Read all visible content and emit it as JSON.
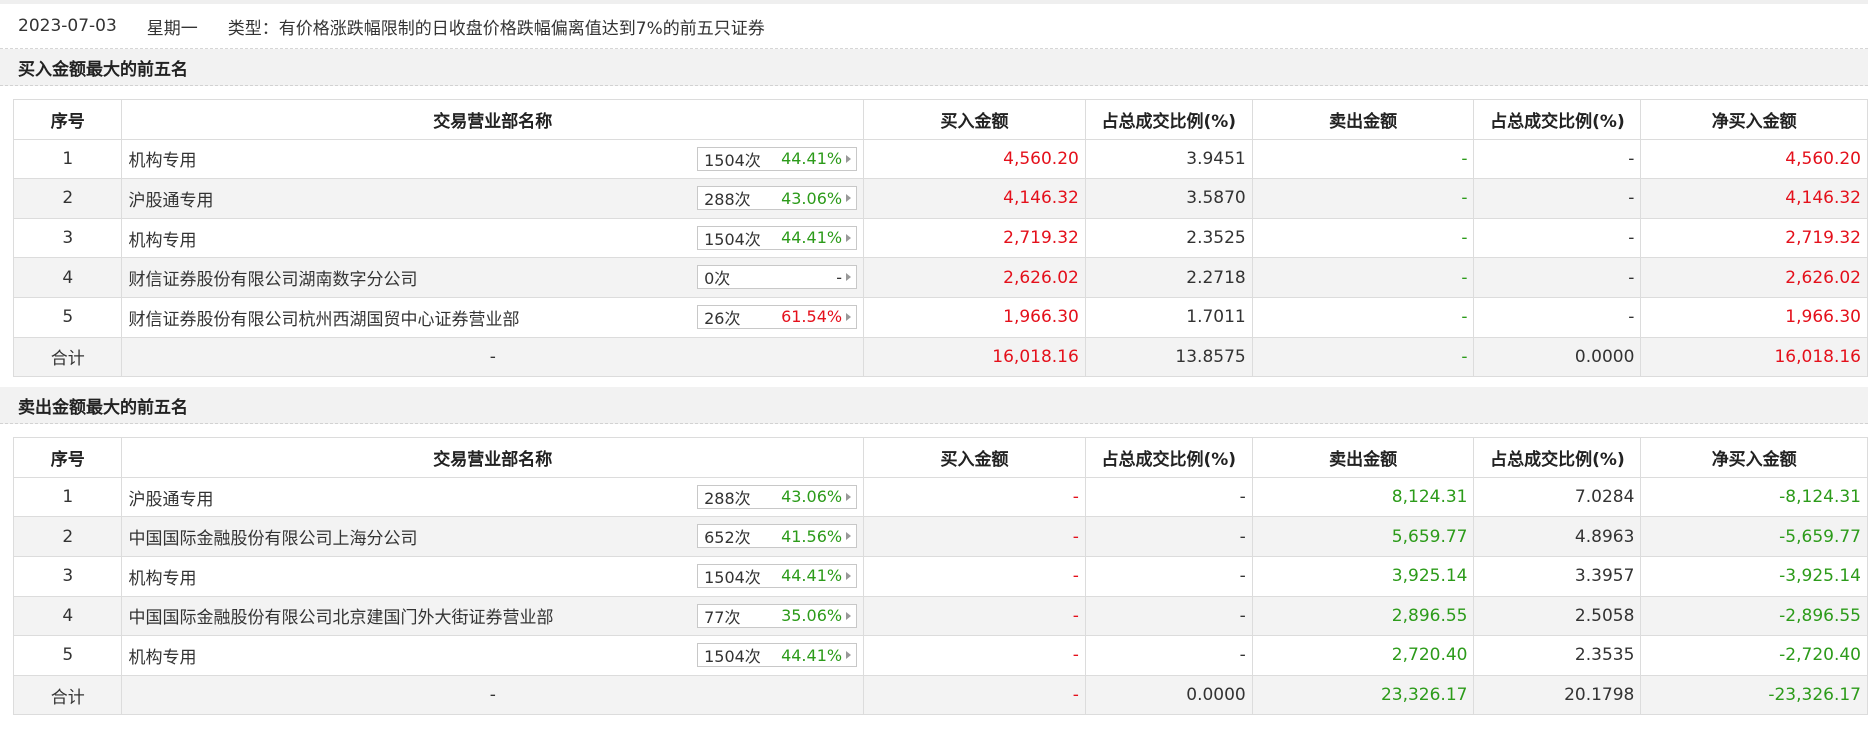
{
  "info": {
    "date": "2023-07-03",
    "weekday": "星期一",
    "type_text": "类型：有价格涨跌幅限制的日收盘价格跌幅偏离值达到7%的前五只证券"
  },
  "columns": [
    "序号",
    "交易营业部名称",
    "买入金额",
    "占总成交比例(%)",
    "卖出金额",
    "占总成交比例(%)",
    "净买入金额"
  ],
  "buy_section": {
    "title": "买入金额最大的前五名",
    "rows": [
      {
        "idx": "1",
        "name": "机构专用",
        "count": "1504次",
        "pct": "44.41%",
        "pct_color": "green",
        "buy": "4,560.20",
        "buy_ratio": "3.9451",
        "sell": "-",
        "sell_ratio": "-",
        "net": "4,560.20"
      },
      {
        "idx": "2",
        "name": "沪股通专用",
        "count": "288次",
        "pct": "43.06%",
        "pct_color": "green",
        "buy": "4,146.32",
        "buy_ratio": "3.5870",
        "sell": "-",
        "sell_ratio": "-",
        "net": "4,146.32"
      },
      {
        "idx": "3",
        "name": "机构专用",
        "count": "1504次",
        "pct": "44.41%",
        "pct_color": "green",
        "buy": "2,719.32",
        "buy_ratio": "2.3525",
        "sell": "-",
        "sell_ratio": "-",
        "net": "2,719.32"
      },
      {
        "idx": "4",
        "name": "财信证券股份有限公司湖南数字分公司",
        "count": "0次",
        "pct": "-",
        "pct_color": "gray",
        "buy": "2,626.02",
        "buy_ratio": "2.2718",
        "sell": "-",
        "sell_ratio": "-",
        "net": "2,626.02"
      },
      {
        "idx": "5",
        "name": "财信证券股份有限公司杭州西湖国贸中心证券营业部",
        "count": "26次",
        "pct": "61.54%",
        "pct_color": "red",
        "buy": "1,966.30",
        "buy_ratio": "1.7011",
        "sell": "-",
        "sell_ratio": "-",
        "net": "1,966.30"
      }
    ],
    "total": {
      "idx": "合计",
      "name": "-",
      "buy": "16,018.16",
      "buy_ratio": "13.8575",
      "sell": "-",
      "sell_ratio": "0.0000",
      "net": "16,018.16"
    }
  },
  "sell_section": {
    "title": "卖出金额最大的前五名",
    "rows": [
      {
        "idx": "1",
        "name": "沪股通专用",
        "count": "288次",
        "pct": "43.06%",
        "pct_color": "green",
        "buy": "-",
        "buy_ratio": "-",
        "sell": "8,124.31",
        "sell_ratio": "7.0284",
        "net": "-8,124.31"
      },
      {
        "idx": "2",
        "name": "中国国际金融股份有限公司上海分公司",
        "count": "652次",
        "pct": "41.56%",
        "pct_color": "green",
        "buy": "-",
        "buy_ratio": "-",
        "sell": "5,659.77",
        "sell_ratio": "4.8963",
        "net": "-5,659.77"
      },
      {
        "idx": "3",
        "name": "机构专用",
        "count": "1504次",
        "pct": "44.41%",
        "pct_color": "green",
        "buy": "-",
        "buy_ratio": "-",
        "sell": "3,925.14",
        "sell_ratio": "3.3957",
        "net": "-3,925.14"
      },
      {
        "idx": "4",
        "name": "中国国际金融股份有限公司北京建国门外大街证券营业部",
        "count": "77次",
        "pct": "35.06%",
        "pct_color": "green",
        "buy": "-",
        "buy_ratio": "-",
        "sell": "2,896.55",
        "sell_ratio": "2.5058",
        "net": "-2,896.55"
      },
      {
        "idx": "5",
        "name": "机构专用",
        "count": "1504次",
        "pct": "44.41%",
        "pct_color": "green",
        "buy": "-",
        "buy_ratio": "-",
        "sell": "2,720.40",
        "sell_ratio": "2.3535",
        "net": "-2,720.40"
      }
    ],
    "total": {
      "idx": "合计",
      "name": "-",
      "buy": "-",
      "buy_ratio": "0.0000",
      "sell": "23,326.17",
      "sell_ratio": "20.1798",
      "net": "-23,326.17"
    }
  },
  "colors": {
    "red": "#e4101b",
    "green": "#2c9b1a",
    "gray": "#333333"
  }
}
